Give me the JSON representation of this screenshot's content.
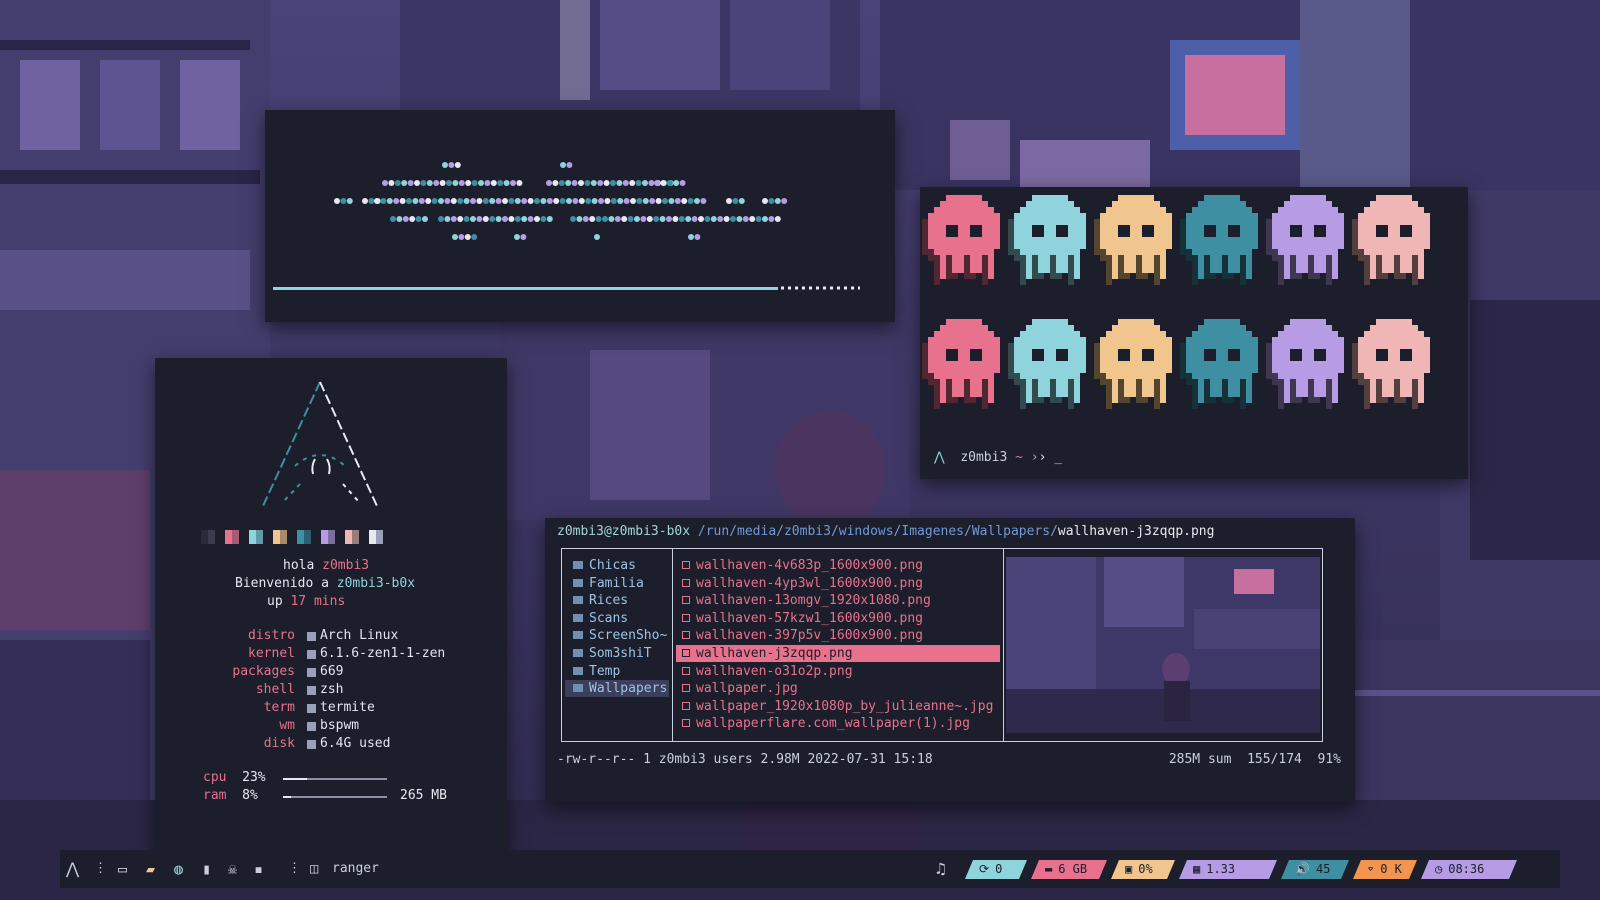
{
  "colors": {
    "background": "#1c1e2b",
    "pink": "#e8718d",
    "cyan": "#8fd4dc",
    "yellow": "#f1c68e",
    "teal": "#3f8fa2",
    "lavender": "#b69be5",
    "peach": "#f0b6b6"
  },
  "skull_colors": [
    "#e8718d",
    "#8fd4dc",
    "#f1c68e",
    "#3f8fa2",
    "#b69be5",
    "#f0b6b6"
  ],
  "terminal": {
    "prompt_user": "z0mbi3",
    "prompt_sep": "~",
    "prompt_arrow": "›",
    "cursor": "_"
  },
  "fetch": {
    "greeting_word": "hola",
    "user": "z0mbi3",
    "welcome": "Bienvenido a",
    "host": "z0mbi3-b0x",
    "up_word": "up",
    "uptime_num": "17",
    "uptime_unit": "mins",
    "info": [
      {
        "label": "distro",
        "value": "Arch Linux"
      },
      {
        "label": "kernel",
        "value": "6.1.6-zen1-1-zen"
      },
      {
        "label": "packages",
        "value": "669"
      },
      {
        "label": "shell",
        "value": "zsh"
      },
      {
        "label": "term",
        "value": "termite"
      },
      {
        "label": "wm",
        "value": "bspwm"
      },
      {
        "label": "disk",
        "value": "6.4G used"
      }
    ],
    "cpu_label": "cpu",
    "cpu_value": "23%",
    "cpu_fraction": 0.23,
    "ram_label": "ram",
    "ram_value": "8%",
    "ram_fraction": 0.08,
    "ram_amount": "265 MB"
  },
  "ranger": {
    "host": "z0mbi3@z0mbi3-b0x",
    "path": "/run/media/z0mbi3/windows/Imagenes/Wallpapers/",
    "current_file": "wallhaven-j3zqqp.png",
    "folders": [
      "Chicas",
      "Familia",
      "Rices",
      "Scans",
      "ScreenSho~",
      "Som3shiT",
      "Temp",
      "Wallpapers"
    ],
    "files": [
      "wallhaven-4v683p_1600x900.png",
      "wallhaven-4yp3wl_1600x900.png",
      "wallhaven-13omgv_1920x1080.png",
      "wallhaven-57kzw1_1600x900.png",
      "wallhaven-397p5v_1600x900.png",
      "wallhaven-j3zqqp.png",
      "wallhaven-o31o2p.png",
      "wallpaper.jpg",
      "wallpaper_1920x1080p_by_julieanne~.jpg",
      "wallpaperflare.com_wallpaper(1).jpg"
    ],
    "selected_index": 5,
    "status_left": "-rw-r--r-- 1 z0mbi3 users 2.98M 2022-07-31 15:18",
    "status_right": "285M sum  155/174  91%"
  },
  "taskbar": {
    "window_name": "ranger",
    "modules": [
      {
        "icon": "updates-icon",
        "glyph": "⟳",
        "text": "0",
        "color": "#8fd4dc"
      },
      {
        "icon": "disk-icon",
        "glyph": "▬",
        "text": "6 GB",
        "color": "#e8718d"
      },
      {
        "icon": "cpu-icon",
        "glyph": "▣",
        "text": "0%",
        "color": "#f1c68e"
      },
      {
        "icon": "memory-icon",
        "glyph": "▦",
        "text": "1.33 GiB",
        "color": "#b69be5"
      },
      {
        "icon": "volume-icon",
        "glyph": "🔊",
        "text": "45",
        "color": "#3f8fa2"
      },
      {
        "icon": "wifi-icon",
        "glyph": "⌔",
        "text": "0 K",
        "color": "#f3944f"
      },
      {
        "icon": "clock-icon",
        "glyph": "◷",
        "text": "08:36 pm",
        "color": "#b69be5"
      }
    ]
  }
}
